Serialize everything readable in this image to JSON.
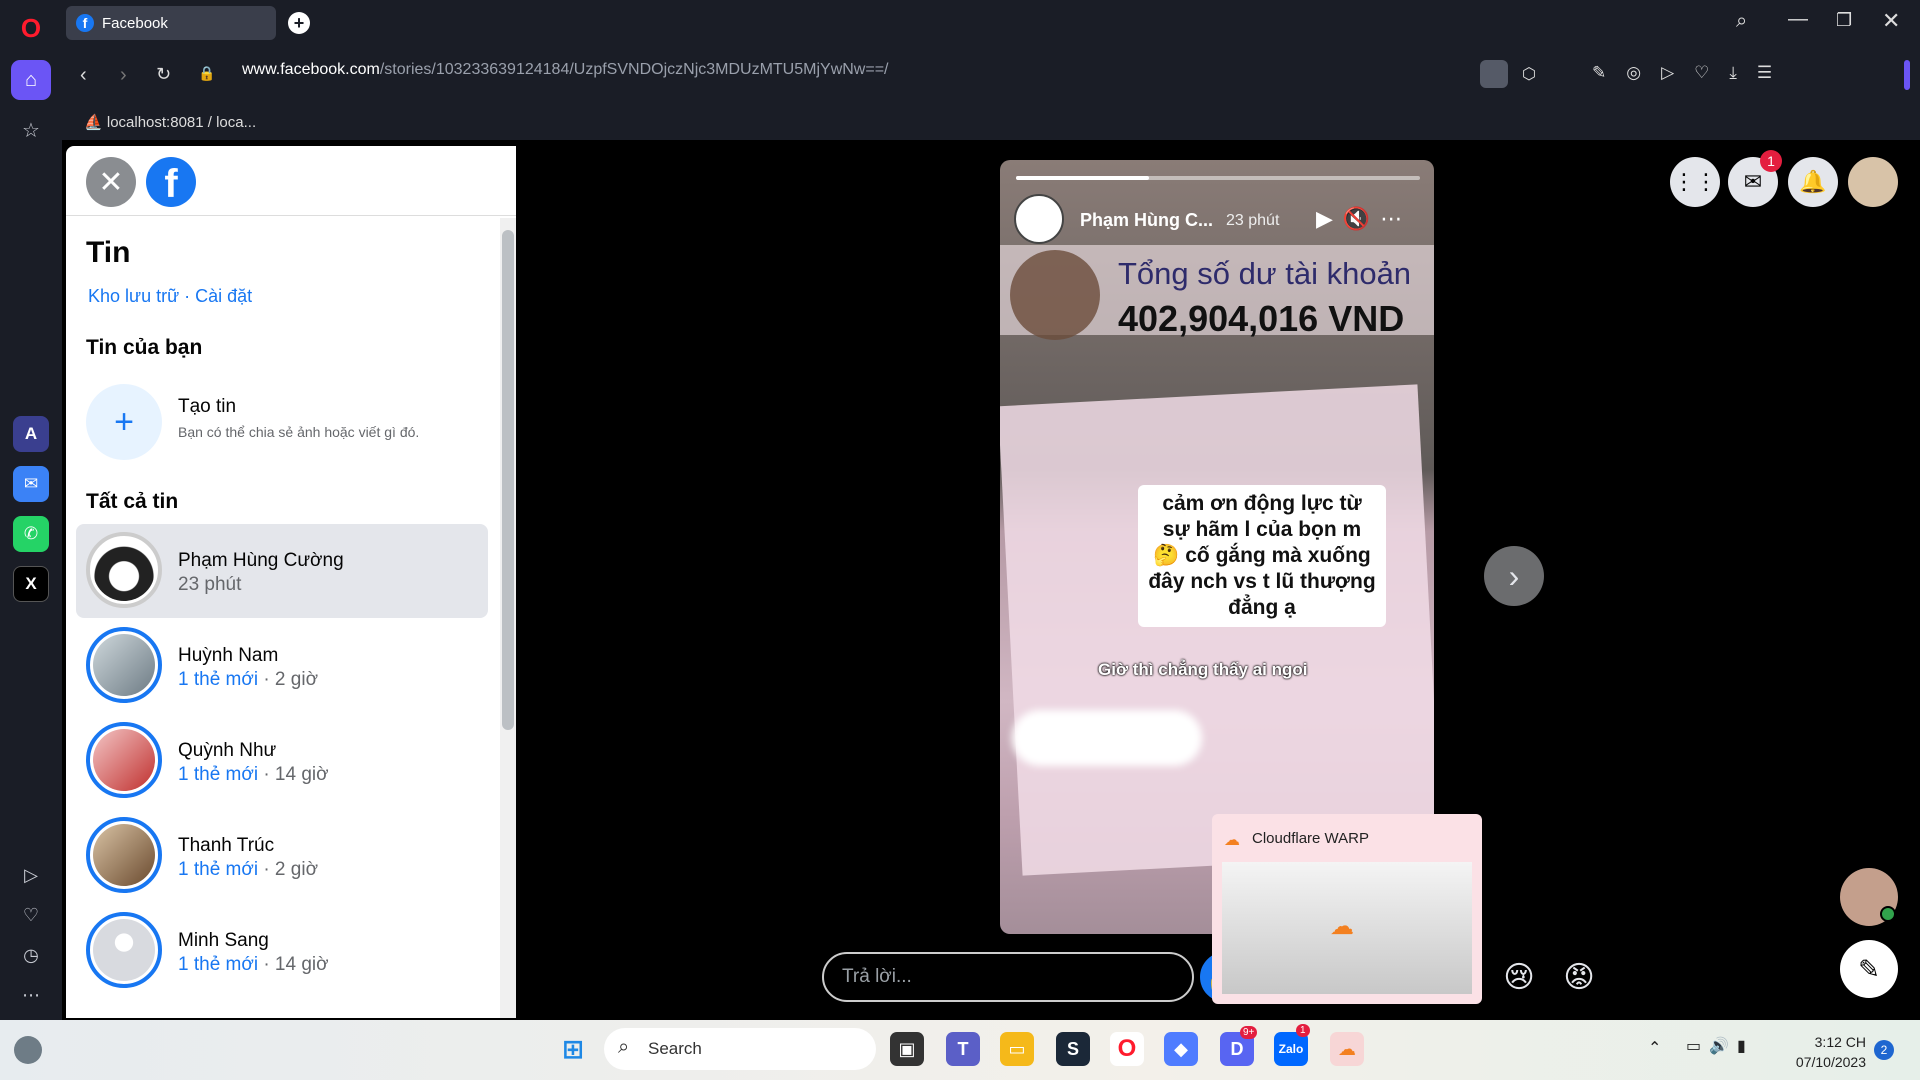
{
  "browser": {
    "tab_title": "Facebook",
    "url_host": "www.facebook.com",
    "url_path": "/stories/103233639124184/UzpfSVNDOjczNjc3MDUzMTU5MjYwNw==/",
    "bookmark": "localhost:8081 / loca..."
  },
  "sidebar": {
    "title": "Tin",
    "archive_link": "Kho lưu trữ",
    "separator": " · ",
    "settings_link": "Cài đặt",
    "your_story_heading": "Tin của bạn",
    "create_title": "Tạo tin",
    "create_desc": "Bạn có thể chia sẻ ảnh hoặc viết gì đó.",
    "all_stories_heading": "Tất cả tin",
    "stories": [
      {
        "name": "Phạm Hùng Cường",
        "new": "",
        "time": "23 phút",
        "seen": true
      },
      {
        "name": "Huỳnh Nam",
        "new": "1 thẻ mới",
        "time": " · 2 giờ",
        "seen": false
      },
      {
        "name": "Quỳnh Như",
        "new": "1 thẻ mới",
        "time": " · 14 giờ",
        "seen": false
      },
      {
        "name": "Thanh Trúc",
        "new": "1 thẻ mới",
        "time": " · 2 giờ",
        "seen": false
      },
      {
        "name": "Minh Sang",
        "new": "1 thẻ mới",
        "time": " · 14 giờ",
        "seen": false
      }
    ]
  },
  "story": {
    "author": "Phạm Hùng C...",
    "time": "23 phút",
    "progress": 0.33,
    "bank_line1": "Tổng số dư tài khoản",
    "bank_line2": "402,904,016 VND",
    "bubble_text": "cảm ơn động lực từ sự hãm l của bọn m 🤔 cố gắng mà xuống đây nch vs t lũ thượng đẳng ạ",
    "caption": "Giờ thì chẳng thấy ai ngoi",
    "reply_placeholder": "Trả lời..."
  },
  "header_icons": {
    "messenger_badge": "1"
  },
  "popup": {
    "title": "Cloudflare WARP"
  },
  "taskbar": {
    "search": "Search",
    "time": "3:12 CH",
    "date": "07/10/2023",
    "notif": "2",
    "discord_badge": "9+",
    "zalo_badge": "1"
  },
  "colors": {
    "fb_blue": "#1877f2",
    "dark_bg": "#000000",
    "rail": "#1a1d26"
  }
}
